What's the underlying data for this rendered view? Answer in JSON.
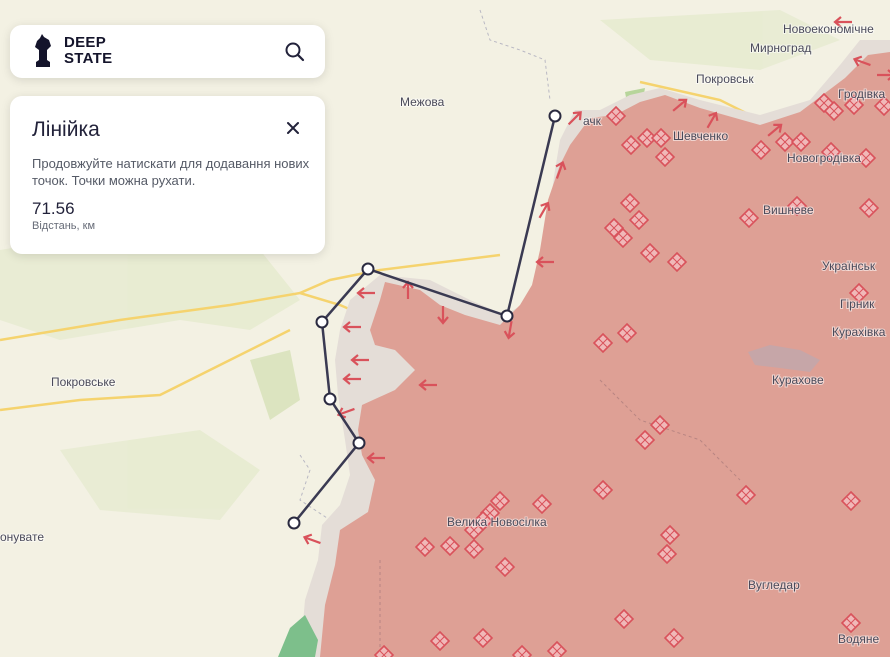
{
  "brand": {
    "line1": "DEEP",
    "line2": "STATE"
  },
  "search": {
    "icon": "search-icon"
  },
  "ruler_panel": {
    "title": "Лінійка",
    "description": "Продовжуйте натискати для додавання нових точок. Точки можна рухати.",
    "distance_value": "71.56",
    "distance_unit": "Відстань, км",
    "close_icon": "close-icon"
  },
  "map": {
    "colors": {
      "land": "#f3f1e3",
      "occupied": "#dea095",
      "contested": "#e4ddd7",
      "attack_arrow": "#d9525b",
      "ruler_line": "#3a3a52",
      "road": "#f5d36e"
    },
    "places": {
      "novoekonomichne": "Новоекономічне",
      "myrnohrad": "Мирноград",
      "pokrovsk": "Покровськ",
      "hrodivka": "Гродівка",
      "mezhova": "Межова",
      "shevchenko": "Шевченко",
      "novohrodivka": "Новогродівка",
      "vyshneve": "Вишневе",
      "ukrainsk": "Українськ",
      "hirnyk": "Гірник",
      "kurakhivka": "Курахівка",
      "kurakhove": "Курахове",
      "pokrovske": "Покровське",
      "velyka_novosilka": "Велика Новосілка",
      "vuhledar": "Вугледар",
      "vodiane": "Водяне",
      "rivnopil": "онувате",
      "kalynove": "ачк"
    }
  }
}
